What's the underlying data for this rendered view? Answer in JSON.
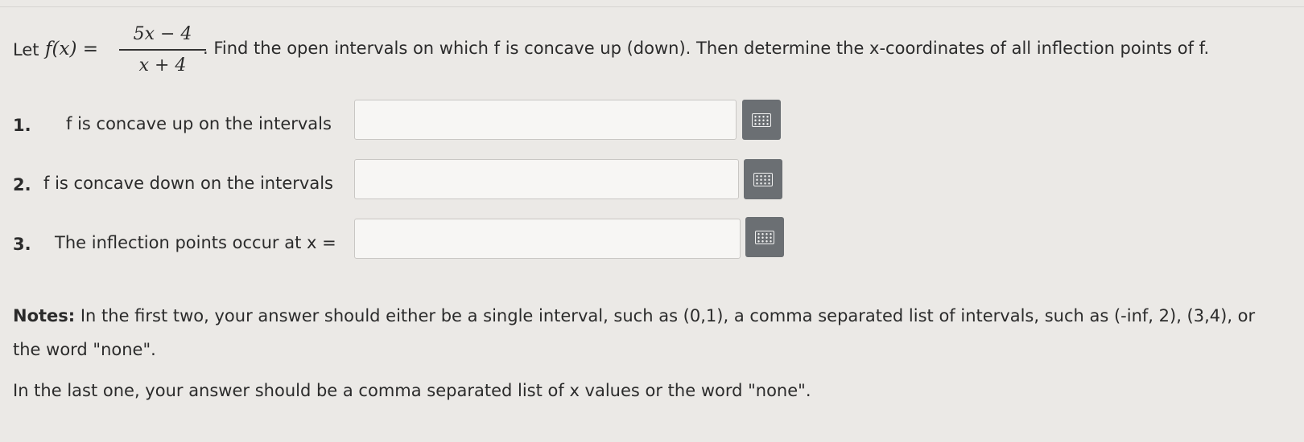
{
  "question": {
    "prefix": "Let",
    "function_lhs": "f(x) =",
    "numerator": "5x − 4",
    "denominator": "x + 4",
    "rest": ". Find the open intervals on which f is concave up (down). Then determine the x-coordinates of all inflection points of f."
  },
  "items": [
    {
      "number": "1.",
      "label": "f is concave up on the intervals",
      "value": ""
    },
    {
      "number": "2.",
      "label": "f is concave down on the intervals",
      "value": ""
    },
    {
      "number": "3.",
      "label": "The inflection points occur at x =",
      "value": ""
    }
  ],
  "notes": {
    "heading": "Notes:",
    "text": " In the first two, your answer should either be a single interval, such as (0,1), a comma separated list of intervals, such as (-inf, 2), (3,4), or the word \"none\".",
    "last": "In the last one, your answer should be a comma separated list of x values or the word \"none\"."
  },
  "icons": {
    "keyboard_button": "keyboard-icon"
  },
  "colors": {
    "button_bg": "#6b6f73",
    "page_bg": "#ebe9e6"
  }
}
